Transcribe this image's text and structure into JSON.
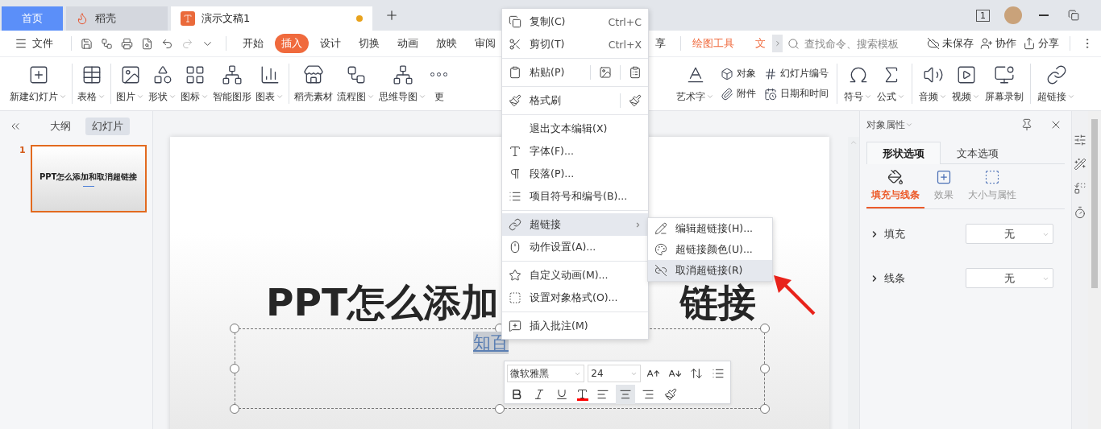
{
  "title_bar": {
    "tabs": [
      {
        "label": "首页",
        "kind": "home",
        "selected": false,
        "modified": false
      },
      {
        "label": "稻壳",
        "kind": "app",
        "selected": false,
        "modified": false
      },
      {
        "label": "演示文稿1",
        "kind": "doc",
        "selected": true,
        "modified": true
      }
    ],
    "view_badge": "1"
  },
  "menu_bar": {
    "file": "文件",
    "tabs": [
      {
        "label": "开始",
        "selected": false
      },
      {
        "label": "插入",
        "selected": true
      },
      {
        "label": "设计",
        "selected": false
      },
      {
        "label": "切换",
        "selected": false
      },
      {
        "label": "动画",
        "selected": false
      },
      {
        "label": "放映",
        "selected": false
      },
      {
        "label": "审阅",
        "selected": false
      }
    ],
    "partial_tab": "享",
    "tool_tabs": [
      "绘图工具",
      "文"
    ],
    "search": {
      "placeholder": "查找命令、搜索模板"
    },
    "actions": [
      "未保存",
      "协作",
      "分享"
    ]
  },
  "ribbon": {
    "left_tools": [
      {
        "kind": "large",
        "label": "新建幻灯片",
        "dropdown": true
      },
      {
        "kind": "large",
        "label": "表格",
        "dropdown": true
      },
      {
        "kind": "large",
        "label": "图片",
        "dropdown": true
      },
      {
        "kind": "large",
        "label": "形状",
        "dropdown": true
      },
      {
        "kind": "large",
        "label": "图标",
        "dropdown": true
      },
      {
        "kind": "large",
        "label": "智能图形",
        "dropdown": false
      },
      {
        "kind": "large",
        "label": "图表",
        "dropdown": true
      },
      {
        "kind": "large",
        "label": "稻壳素材",
        "dropdown": false
      },
      {
        "kind": "large",
        "label": "流程图",
        "dropdown": true
      },
      {
        "kind": "large",
        "label": "思维导图",
        "dropdown": true
      },
      {
        "kind": "large",
        "label": "更",
        "dropdown": false
      }
    ],
    "right_tools": [
      {
        "kind": "large",
        "label": "艺术字",
        "dropdown": true
      },
      {
        "kind": "stack",
        "items": [
          {
            "label": "对象"
          },
          {
            "label": "附件"
          }
        ]
      },
      {
        "kind": "stack",
        "items": [
          {
            "label": "幻灯片编号"
          },
          {
            "label": "日期和时间"
          }
        ]
      },
      {
        "kind": "large",
        "label": "符号",
        "dropdown": true
      },
      {
        "kind": "large",
        "label": "公式",
        "dropdown": true
      },
      {
        "kind": "large",
        "label": "音频",
        "dropdown": true
      },
      {
        "kind": "large",
        "label": "视频",
        "dropdown": true
      },
      {
        "kind": "large",
        "label": "屏幕录制",
        "dropdown": false
      },
      {
        "kind": "large",
        "label": "超链接",
        "dropdown": true
      }
    ]
  },
  "slide_panel": {
    "tabs": [
      {
        "label": "大纲",
        "selected": false
      },
      {
        "label": "幻灯片",
        "selected": true
      }
    ],
    "slides": [
      {
        "number": "1",
        "title": "PPT怎么添加和取消超链接",
        "selected": true
      }
    ]
  },
  "slide": {
    "title_parts": [
      "PPT怎么添加",
      "链接"
    ],
    "subtitle": "知百",
    "subtitle_selected": true
  },
  "mini_toolbar": {
    "font": "微软雅黑",
    "size": "24",
    "align_buttons": [
      {
        "selected": false
      },
      {
        "selected": true
      },
      {
        "selected": false
      }
    ]
  },
  "context_menu": {
    "groups": [
      [
        {
          "label": "复制(C)",
          "shortcut": "Ctrl+C",
          "kind": "plain",
          "selected": false,
          "submenu": false
        },
        {
          "label": "剪切(T)",
          "shortcut": "Ctrl+X",
          "kind": "plain",
          "selected": false,
          "submenu": false
        }
      ],
      [
        {
          "label": "粘贴(P)",
          "kind": "paste",
          "selected": false,
          "submenu": false
        }
      ],
      [
        {
          "label": "格式刷",
          "kind": "painter",
          "selected": false,
          "submenu": false
        }
      ],
      [
        {
          "label": "退出文本编辑(X)",
          "kind": "plain",
          "selected": false,
          "submenu": false
        },
        {
          "label": "字体(F)...",
          "kind": "plain",
          "selected": false,
          "submenu": false
        },
        {
          "label": "段落(P)...",
          "kind": "plain",
          "selected": false,
          "submenu": false
        },
        {
          "label": "项目符号和编号(B)...",
          "kind": "plain",
          "selected": false,
          "submenu": false
        }
      ],
      [
        {
          "label": "超链接",
          "kind": "plain",
          "selected": true,
          "submenu": true
        },
        {
          "label": "动作设置(A)...",
          "kind": "plain",
          "selected": false,
          "submenu": false
        }
      ],
      [
        {
          "label": "自定义动画(M)...",
          "kind": "plain",
          "selected": false,
          "submenu": false
        },
        {
          "label": "设置对象格式(O)...",
          "kind": "plain",
          "selected": false,
          "submenu": false
        }
      ],
      [
        {
          "label": "插入批注(M)",
          "kind": "plain",
          "selected": false,
          "submenu": false
        }
      ]
    ]
  },
  "submenu": {
    "items": [
      {
        "label": "编辑超链接(H)...",
        "selected": false
      },
      {
        "label": "超链接颜色(U)...",
        "selected": false
      },
      {
        "label": "取消超链接(R)",
        "selected": true
      }
    ]
  },
  "properties_panel": {
    "title": "对象属性",
    "tabs": [
      {
        "label": "形状选项",
        "selected": true
      },
      {
        "label": "文本选项",
        "selected": false
      }
    ],
    "subtabs": [
      {
        "label": "填充与线条",
        "selected": true
      },
      {
        "label": "效果",
        "selected": false
      },
      {
        "label": "大小与属性",
        "selected": false
      }
    ],
    "rows": [
      {
        "label": "填充",
        "value": "无",
        "expanded": false
      },
      {
        "label": "线条",
        "value": "无",
        "expanded": false
      }
    ]
  }
}
